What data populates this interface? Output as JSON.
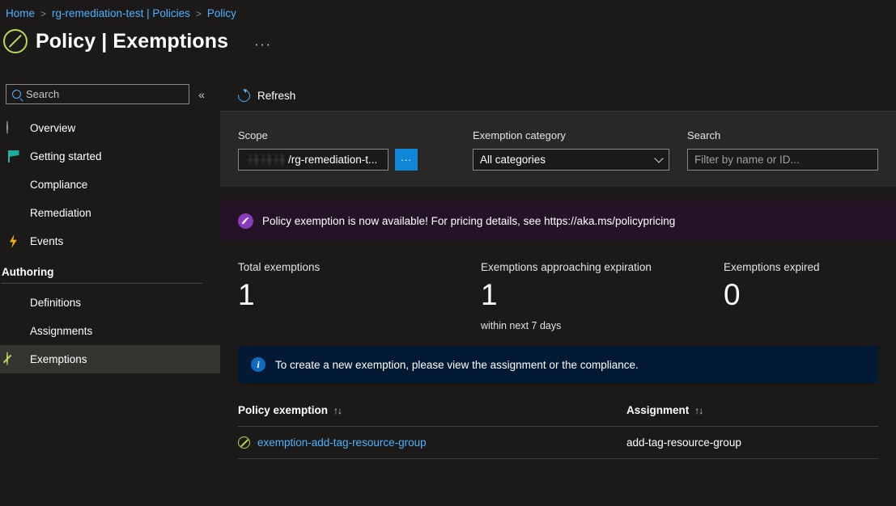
{
  "breadcrumb": [
    {
      "label": "Home"
    },
    {
      "label": "rg-remediation-test | Policies"
    },
    {
      "label": "Policy"
    }
  ],
  "header": {
    "title": "Policy | Exemptions",
    "more_label": "···",
    "icon": "exemption-icon"
  },
  "sidebar": {
    "search": {
      "placeholder": "Search",
      "value": ""
    },
    "collapse_label": "«",
    "items": [
      {
        "label": "Overview",
        "icon": "overview-icon"
      },
      {
        "label": "Getting started",
        "icon": "flag-icon"
      },
      {
        "label": "Compliance",
        "icon": "compliance-document-icon"
      },
      {
        "label": "Remediation",
        "icon": "remediation-icon"
      },
      {
        "label": "Events",
        "icon": "lightning-bolt-icon"
      }
    ],
    "section_title": "Authoring",
    "authoring_items": [
      {
        "label": "Definitions",
        "icon": "definitions-icon",
        "selected": false
      },
      {
        "label": "Assignments",
        "icon": "assignments-icon",
        "selected": false
      },
      {
        "label": "Exemptions",
        "icon": "exemption-icon",
        "selected": true
      }
    ]
  },
  "command_bar": {
    "refresh_label": "Refresh",
    "refresh_icon": "refresh-icon"
  },
  "filters": {
    "scope": {
      "label": "Scope",
      "redacted_prefix": "",
      "value": "/rg-remediation-t...",
      "browse_label": "..."
    },
    "category": {
      "label": "Exemption category",
      "selected": "All categories"
    },
    "search": {
      "label": "Search",
      "placeholder": "Filter by name or ID...",
      "value": ""
    }
  },
  "promo_banner": {
    "icon": "rocket-icon",
    "text": "Policy exemption is now available! For pricing details, see https://aka.ms/policypricing",
    "background": "#241327"
  },
  "metrics": [
    {
      "label": "Total exemptions",
      "value": "1",
      "sub": ""
    },
    {
      "label": "Exemptions approaching expiration",
      "value": "1",
      "sub": "within next 7 days"
    },
    {
      "label": "Exemptions expired",
      "value": "0",
      "sub": ""
    }
  ],
  "info_banner": {
    "icon": "info-icon",
    "text": "To create a new exemption, please view the assignment or the compliance.",
    "background": "#031a35"
  },
  "table": {
    "columns": [
      {
        "label": "Policy exemption",
        "sort_icon": "↑↓"
      },
      {
        "label": "Assignment",
        "sort_icon": "↑↓"
      }
    ],
    "rows": [
      {
        "icon": "exemption-icon",
        "policy_exemption": "exemption-add-tag-resource-group",
        "assignment": "add-tag-resource-group"
      }
    ]
  },
  "colors": {
    "link": "#4db2ff",
    "accent_green": "#b6d957",
    "primary_button": "#0f86d8",
    "page_bg": "#1b1a19",
    "panel_bg": "#292827"
  }
}
